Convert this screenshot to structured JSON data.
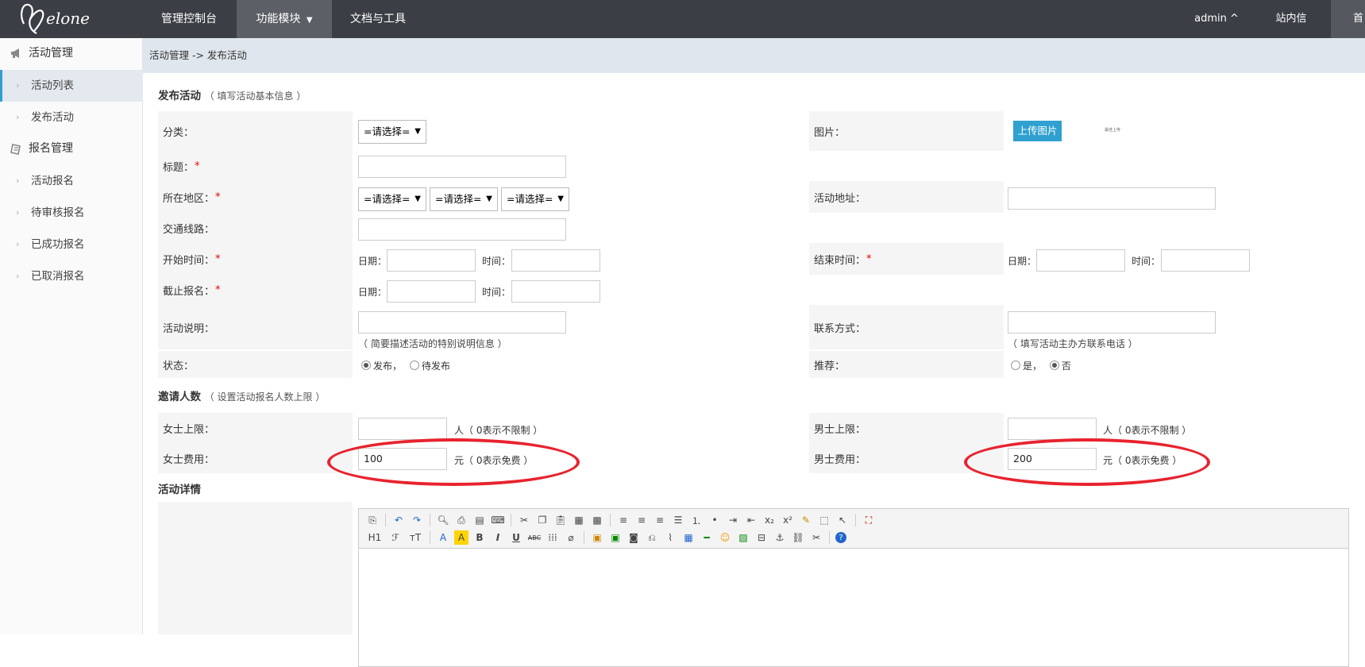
{
  "topbar": {
    "logo_text": "Melone",
    "nav": [
      "管理控制台",
      "功能模块",
      "文档与工具"
    ],
    "user": "admin ^",
    "messages": "站内信",
    "right_cut": "首"
  },
  "sidebar": {
    "groups": [
      {
        "label": "活动管理",
        "items": [
          "活动列表",
          "发布活动"
        ]
      },
      {
        "label": "报名管理",
        "items": [
          "活动报名",
          "待审核报名",
          "已成功报名",
          "已取消报名"
        ]
      }
    ]
  },
  "breadcrumb": "活动管理 -> 发布活动",
  "form": {
    "section_basic": {
      "title": "发布活动",
      "hint": "（ 填写活动基本信息 ）"
    },
    "labels": {
      "category": "分类：",
      "image": "图片：",
      "title": "标题：",
      "region": "所在地区：",
      "address": "活动地址：",
      "transport": "交通线路：",
      "start_time": "开始时间：",
      "end_time": "结束时间：",
      "deadline": "截止报名：",
      "description": "活动说明：",
      "contact": "联系方式：",
      "status": "状态：",
      "recommend": "推荐：",
      "female_limit": "女士上限：",
      "male_limit": "男士上限：",
      "female_fee": "女士费用：",
      "male_fee": "男士费用："
    },
    "required_mark": "*",
    "select_placeholder": "=请选择=",
    "upload_button": "上传图片",
    "upload_note": "最佳上传",
    "date_label": "日期：",
    "time_label": "时间：",
    "description_hint": "（ 简要描述活动的特别说明信息 ）",
    "contact_hint": "（ 填写活动主办方联系电话 ）",
    "status_options": [
      "发布，",
      "待发布"
    ],
    "status_selected": "发布",
    "recommend_options": [
      "是，",
      "否"
    ],
    "recommend_selected": "否",
    "section_invite": {
      "title": "邀请人数",
      "hint": "（ 设置活动报名人数上限 ）"
    },
    "limit_unit": "人（ 0表示不限制 ）",
    "fee_unit": "元（ 0表示免费 ）",
    "female_fee_value": "100",
    "male_fee_value": "200",
    "section_detail": {
      "title": "活动详情"
    }
  },
  "editor": {
    "row1_icons": [
      "source-icon",
      "undo-icon",
      "redo-icon",
      "preview-icon",
      "print-icon",
      "template-icon",
      "code-icon",
      "cut-icon",
      "copy-icon",
      "paste-icon",
      "paste-text-icon",
      "paste-word-icon",
      "align-left-icon",
      "align-center-icon",
      "align-right-icon",
      "justify-icon",
      "ordered-list-icon",
      "unordered-list-icon",
      "indent-icon",
      "outdent-icon",
      "subscript-icon",
      "superscript-icon",
      "clear-format-icon",
      "select-all-icon",
      "pointer-icon",
      "fullscreen-icon"
    ],
    "row2_labels": [
      "H1",
      "ℱ",
      "тT",
      "A",
      "A",
      "B",
      "I",
      "U",
      "ABC",
      "⁞⁞⁞",
      "⌀"
    ]
  },
  "colors": {
    "topbar": "#3b3f45",
    "accent": "#2fa0d0",
    "annotation": "#e8232e",
    "crumbbar": "#e0e6ed"
  }
}
